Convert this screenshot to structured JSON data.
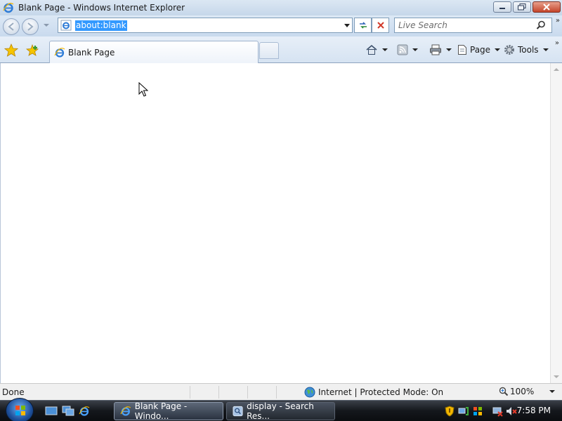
{
  "window": {
    "title": "Blank Page - Windows Internet Explorer"
  },
  "navbar": {
    "address": "about:blank",
    "search_placeholder": "Live Search"
  },
  "tabs": [
    {
      "label": "Blank Page"
    }
  ],
  "command_bar": {
    "page_label": "Page",
    "tools_label": "Tools"
  },
  "status": {
    "text": "Done",
    "zone": "Internet | Protected Mode: On",
    "zoom": "100%"
  },
  "taskbar": {
    "tasks": [
      {
        "label": "Blank Page - Windo..."
      },
      {
        "label": "display - Search Res..."
      }
    ],
    "clock": "7:58 PM"
  },
  "icons": {
    "back": "back-arrow-icon",
    "forward": "forward-arrow-icon",
    "refresh": "refresh-icon",
    "stop": "stop-icon",
    "search": "search-icon",
    "favorites": "favorites-star-icon",
    "add_favorites": "add-favorites-icon",
    "home": "home-icon",
    "feeds": "rss-feeds-icon",
    "print": "print-icon",
    "page": "page-icon",
    "tools": "gear-icon"
  },
  "colors": {
    "selection": "#3399ff",
    "titlebar": "#c6d7ea"
  }
}
